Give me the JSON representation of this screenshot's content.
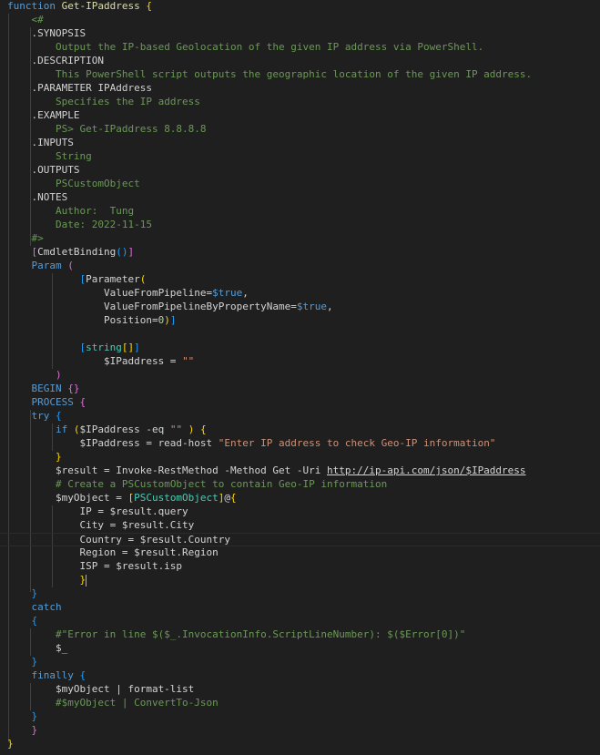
{
  "editor": {
    "language": "PowerShell",
    "theme_background": "#1f1f1f",
    "lines": [
      [
        [
          "kw",
          "function"
        ],
        [
          "pl",
          " "
        ],
        [
          "fn",
          "Get-IPaddress"
        ],
        [
          "pl",
          " "
        ],
        [
          "b1",
          "{"
        ]
      ],
      [
        [
          "pl",
          "    "
        ],
        [
          "cm",
          "<#"
        ]
      ],
      [
        [
          "pl",
          "    "
        ],
        [
          "pl",
          ".SYNOPSIS"
        ]
      ],
      [
        [
          "pl",
          "        "
        ],
        [
          "cm",
          "Output the IP-based Geolocation of the given IP address via PowerShell."
        ]
      ],
      [
        [
          "pl",
          "    "
        ],
        [
          "pl",
          ".DESCRIPTION"
        ]
      ],
      [
        [
          "pl",
          "        "
        ],
        [
          "cm",
          "This PowerShell script outputs the geographic location of the given IP address."
        ]
      ],
      [
        [
          "pl",
          "    "
        ],
        [
          "pl",
          ".PARAMETER IPAddress"
        ]
      ],
      [
        [
          "pl",
          "        "
        ],
        [
          "cm",
          "Specifies the IP address"
        ]
      ],
      [
        [
          "pl",
          "    "
        ],
        [
          "pl",
          ".EXAMPLE"
        ]
      ],
      [
        [
          "pl",
          "        "
        ],
        [
          "cm",
          "PS> Get-IPaddress 8.8.8.8"
        ]
      ],
      [
        [
          "pl",
          "    "
        ],
        [
          "pl",
          ".INPUTS"
        ]
      ],
      [
        [
          "pl",
          "        "
        ],
        [
          "cm",
          "String"
        ]
      ],
      [
        [
          "pl",
          "    "
        ],
        [
          "pl",
          ".OUTPUTS"
        ]
      ],
      [
        [
          "pl",
          "        "
        ],
        [
          "cm",
          "PSCustomObject"
        ]
      ],
      [
        [
          "pl",
          "    "
        ],
        [
          "pl",
          ".NOTES"
        ]
      ],
      [
        [
          "pl",
          "        "
        ],
        [
          "cm",
          "Author:  Tung"
        ]
      ],
      [
        [
          "pl",
          "        "
        ],
        [
          "cm",
          "Date: 2022-11-15"
        ]
      ],
      [
        [
          "pl",
          "    "
        ],
        [
          "cm",
          "#>"
        ]
      ],
      [
        [
          "pl",
          "    "
        ],
        [
          "b2",
          "["
        ],
        [
          "pl",
          "CmdletBinding"
        ],
        [
          "b3",
          "()"
        ],
        [
          "b2",
          "]"
        ]
      ],
      [
        [
          "pl",
          "    "
        ],
        [
          "kw",
          "Param"
        ],
        [
          "pl",
          " "
        ],
        [
          "b2",
          "("
        ]
      ],
      [
        [
          "pl",
          "            "
        ],
        [
          "b3",
          "["
        ],
        [
          "pl",
          "Parameter"
        ],
        [
          "b1",
          "("
        ]
      ],
      [
        [
          "pl",
          "                ValueFromPipeline="
        ],
        [
          "bool",
          "$true"
        ],
        [
          "pl",
          ","
        ]
      ],
      [
        [
          "pl",
          "                ValueFromPipelineByPropertyName="
        ],
        [
          "bool",
          "$true"
        ],
        [
          "pl",
          ","
        ]
      ],
      [
        [
          "pl",
          "                Position="
        ],
        [
          "num",
          "0"
        ],
        [
          "b1",
          ")"
        ],
        [
          "b3",
          "]"
        ]
      ],
      [
        [
          "pl",
          ""
        ]
      ],
      [
        [
          "pl",
          "            "
        ],
        [
          "b3",
          "["
        ],
        [
          "type",
          "string"
        ],
        [
          "b1",
          "[]"
        ],
        [
          "b3",
          "]"
        ]
      ],
      [
        [
          "pl",
          "                $IPaddress = "
        ],
        [
          "st",
          "\"\""
        ]
      ],
      [
        [
          "pl",
          "        "
        ],
        [
          "b2",
          ")"
        ]
      ],
      [
        [
          "pl",
          "    "
        ],
        [
          "kw",
          "BEGIN"
        ],
        [
          "pl",
          " "
        ],
        [
          "b2",
          "{}"
        ]
      ],
      [
        [
          "pl",
          "    "
        ],
        [
          "kw",
          "PROCESS"
        ],
        [
          "pl",
          " "
        ],
        [
          "b2",
          "{"
        ]
      ],
      [
        [
          "pl",
          "    "
        ],
        [
          "kw",
          "try"
        ],
        [
          "pl",
          " "
        ],
        [
          "b3",
          "{"
        ]
      ],
      [
        [
          "pl",
          "        "
        ],
        [
          "kw",
          "if"
        ],
        [
          "pl",
          " "
        ],
        [
          "b1",
          "("
        ],
        [
          "pl",
          "$IPaddress -eq "
        ],
        [
          "st",
          "\"\""
        ],
        [
          "pl",
          " "
        ],
        [
          "b1",
          ")"
        ],
        [
          "pl",
          " "
        ],
        [
          "b1",
          "{"
        ]
      ],
      [
        [
          "pl",
          "            $IPaddress = read-host "
        ],
        [
          "st",
          "\"Enter IP address to check Geo-IP information\""
        ]
      ],
      [
        [
          "pl",
          "        "
        ],
        [
          "b1",
          "}"
        ]
      ],
      [
        [
          "pl",
          "        $result = Invoke-RestMethod -Method Get -Uri "
        ],
        [
          "url",
          "http://ip-api.com/json/$IPaddress"
        ]
      ],
      [
        [
          "pl",
          "        "
        ],
        [
          "cm",
          "# Create a PSCustomObject to contain Geo-IP information"
        ]
      ],
      [
        [
          "pl",
          "        $myObject = "
        ],
        [
          "b1",
          "["
        ],
        [
          "type",
          "PSCustomObject"
        ],
        [
          "b1",
          "]"
        ],
        [
          "pl",
          "@"
        ],
        [
          "b1",
          "{"
        ]
      ],
      [
        [
          "pl",
          "            IP = $result.query"
        ]
      ],
      [
        [
          "pl",
          "            City = $result.City"
        ]
      ],
      [
        [
          "pl",
          "            Country = $result.Country"
        ]
      ],
      [
        [
          "pl",
          "            Region = $result.Region"
        ]
      ],
      [
        [
          "pl",
          "            ISP = $result.isp"
        ]
      ],
      [
        [
          "pl",
          "            "
        ],
        [
          "b1",
          "}"
        ]
      ],
      [
        [
          "pl",
          "    "
        ],
        [
          "b3",
          "}"
        ]
      ],
      [
        [
          "pl",
          "    "
        ],
        [
          "kw",
          "catch"
        ]
      ],
      [
        [
          "pl",
          "    "
        ],
        [
          "b3",
          "{"
        ]
      ],
      [
        [
          "pl",
          "        "
        ],
        [
          "cm",
          "#\"Error in line $($_.InvocationInfo.ScriptLineNumber): $($Error[0])\""
        ]
      ],
      [
        [
          "pl",
          "        $_"
        ]
      ],
      [
        [
          "pl",
          "    "
        ],
        [
          "b3",
          "}"
        ]
      ],
      [
        [
          "pl",
          "    "
        ],
        [
          "kw",
          "finally"
        ],
        [
          "pl",
          " "
        ],
        [
          "b3",
          "{"
        ]
      ],
      [
        [
          "pl",
          "        $myObject | format-list"
        ]
      ],
      [
        [
          "pl",
          "        "
        ],
        [
          "cm",
          "#$myObject | ConvertTo-Json"
        ]
      ],
      [
        [
          "pl",
          "    "
        ],
        [
          "b3",
          "}"
        ]
      ],
      [
        [
          "pl",
          "    "
        ],
        [
          "b2",
          "}"
        ]
      ],
      [
        [
          "b1",
          "}"
        ]
      ]
    ]
  }
}
